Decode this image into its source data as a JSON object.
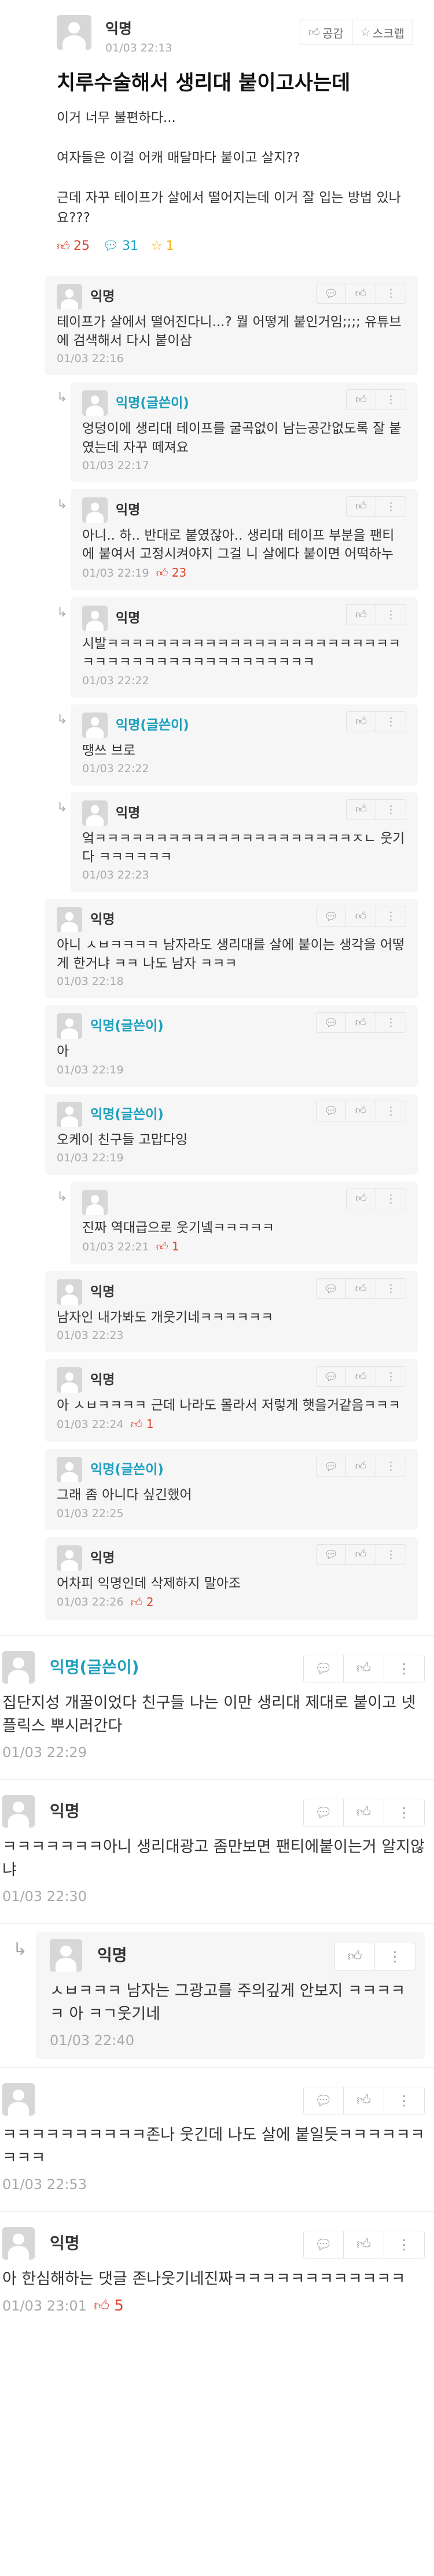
{
  "post": {
    "author": "익명",
    "time": "01/03 22:13",
    "like_label": "공감",
    "scrap_label": "스크랩",
    "title": "치루수술해서 생리대 붙이고사는데",
    "body": "이거 너무 불편하다...\n\n여자들은 이걸 어캐 매달마다 붙이고 살지??\n\n근데 자꾸 테이프가 살에서 떨어지는데 이거 잘 입는 방법 있나요???",
    "likes": "25",
    "comments": "31",
    "scraps": "1"
  },
  "comments": [
    {
      "level": 1,
      "author": "익명",
      "op": false,
      "text": "테이프가 살에서 떨어진다니...? 뭘 어떻게 붙인거임;;;; 유튜브에 검색해서 다시 붙이삼",
      "time": "01/03 22:16",
      "likes": ""
    },
    {
      "level": 2,
      "author": "익명(글쓴이)",
      "op": true,
      "text": "엉덩이에 생리대 테이프를 굴곡없이 남는공간없도록 잘 붙였는데 자꾸 떼져요",
      "time": "01/03 22:17",
      "likes": ""
    },
    {
      "level": 2,
      "author": "익명",
      "op": false,
      "text": "아니.. 하.. 반대로 붙였잖아.. 생리대 테이프 부분을 팬티에 붙여서 고정시켜야지 그걸 니 살에다 붙이면 어떡하누",
      "time": "01/03 22:19",
      "likes": "23"
    },
    {
      "level": 2,
      "author": "익명",
      "op": false,
      "text": "시발ㅋㅋㅋㅋㅋㅋㅋㅋㅋㅋㅋㅋㅋㅋㅋㅋㅋㅋㅋㅋㅋㅋㅋㅋㅋㅋㅋㅋㅋㅋㅋㅋㅋㅋㅋㅋㅋㅋㅋㅋㅋㅋㅋ",
      "time": "01/03 22:22",
      "likes": ""
    },
    {
      "level": 2,
      "author": "익명(글쓴이)",
      "op": true,
      "text": "땡쓰 브로",
      "time": "01/03 22:22",
      "likes": ""
    },
    {
      "level": 2,
      "author": "익명",
      "op": false,
      "text": "엌ㅋㅋㅋㅋㅋㅋㅋㅋㅋㅋㅋㅋㅋㅋㅋㅋㅋㅋㅋㅋㅋㅈㄴ 웃기다 ㅋㅋㅋㅋㅋㅋ",
      "time": "01/03 22:23",
      "likes": ""
    },
    {
      "level": 1,
      "author": "익명",
      "op": false,
      "text": "아니 ㅅㅂㅋㅋㅋㅋ 남자라도 생리대를 살에 붙이는 생각을 어떻게 한거냐 ㅋㅋ 나도 남자 ㅋㅋㅋ",
      "time": "01/03 22:18",
      "likes": ""
    },
    {
      "level": 1,
      "author": "익명(글쓴이)",
      "op": true,
      "text": "아",
      "time": "01/03 22:19",
      "likes": ""
    },
    {
      "level": 1,
      "author": "익명(글쓴이)",
      "op": true,
      "text": "오케이 친구들 고맙다잉",
      "time": "01/03 22:19",
      "likes": ""
    },
    {
      "level": 2,
      "author": "",
      "op": false,
      "text": "진짜 역대급으로 웃기넼ㅋㅋㅋㅋㅋ",
      "time": "01/03 22:21",
      "likes": "1"
    },
    {
      "level": 1,
      "author": "익명",
      "op": false,
      "text": "남자인 내가봐도 개웃기네ㅋㅋㅋㅋㅋㅋ",
      "time": "01/03 22:23",
      "likes": ""
    },
    {
      "level": 1,
      "author": "익명",
      "op": false,
      "text": "아 ㅅㅂㅋㅋㅋㅋ 근데 나라도 몰라서 저렇게 햇을거같음ㅋㅋㅋ",
      "time": "01/03 22:24",
      "likes": "1"
    },
    {
      "level": 1,
      "author": "익명(글쓴이)",
      "op": true,
      "text": "그래 좀 아니다 싶긴했어",
      "time": "01/03 22:25",
      "likes": ""
    },
    {
      "level": 1,
      "author": "익명",
      "op": false,
      "text": "어차피 익명인데 삭제하지 말아조",
      "time": "01/03 22:26",
      "likes": "2"
    }
  ],
  "big_comments": [
    {
      "author": "익명(글쓴이)",
      "op": true,
      "text": "집단지성 개꿀이었다 친구들 나는 이만 생리대 제대로 붙이고 넷플릭스 뿌시러간다",
      "time": "01/03 22:29",
      "likes": ""
    },
    {
      "author": "익명",
      "op": false,
      "text": "ㅋㅋㅋㅋㅋㅋㅋ아니 생리대광고 좀만보면 팬티에붙이는거 알지않냐",
      "time": "01/03 22:30",
      "likes": ""
    },
    {
      "author": "익명",
      "op": false,
      "reply": true,
      "text": "ㅅㅂㅋㅋㅋ 남자는 그광고를 주의깊게 안보지 ㅋㅋㅋㅋㅋ 아 ㅋㄱ웃기네",
      "time": "01/03 22:40",
      "likes": ""
    },
    {
      "author": "",
      "op": false,
      "text": "ㅋㅋㅋㅋㅋㅋㅋㅋㅋㅋ존나 웃긴데 나도 살에 붙일듯ㅋㅋㅋㅋㅋㅋㅋㅋㅋ",
      "time": "01/03 22:53",
      "likes": ""
    },
    {
      "author": "익명",
      "op": false,
      "text": "아 한심해하는 댓글 존나웃기네진짜ㅋㅋㅋㅋㅋㅋㅋㅋㅋㅋㅋㅋ",
      "time": "01/03 23:01",
      "likes": "5"
    }
  ],
  "icons": {
    "like": "thumb-up-icon",
    "comment": "speech-bubble-icon",
    "scrap": "star-icon",
    "more": "more-vertical-icon",
    "reply": "reply-arrow-icon"
  },
  "colors": {
    "op_author": "#1b9fbd",
    "like": "#e0402a",
    "comment": "#1aa5c8",
    "scrap": "#f0b400"
  }
}
